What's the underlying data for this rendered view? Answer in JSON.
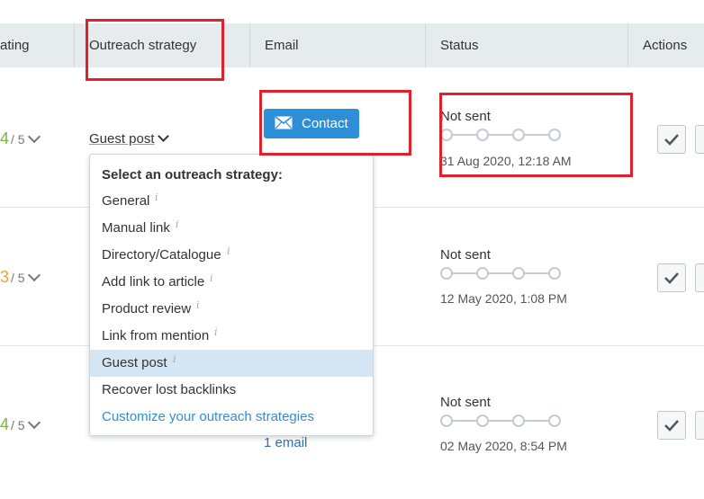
{
  "header": {
    "rating": "ating",
    "outreach": "Outreach strategy",
    "email": "Email",
    "status": "Status",
    "actions": "Actions"
  },
  "rows": [
    {
      "rating": "4",
      "rating_of": "/ 5",
      "rating_color": "#7cb342",
      "status": "Not sent",
      "date": "31 Aug 2020, 12:18 AM"
    },
    {
      "rating": "3",
      "rating_of": "/ 5",
      "rating_color": "#f0a030",
      "status": "Not sent",
      "date": "12 May 2020, 1:08 PM"
    },
    {
      "rating": "4",
      "rating_of": "/ 5",
      "rating_color": "#7cb342",
      "status": "Not sent",
      "date": "02 May 2020, 8:54 PM"
    }
  ],
  "strategy_selected": "Guest post",
  "contact_label": "Contact",
  "email_link": "1 email",
  "dropdown": {
    "title": "Select an outreach strategy:",
    "items": [
      "General",
      "Manual link",
      "Directory/Catalogue",
      "Add link to article",
      "Product review",
      "Link from mention",
      "Guest post",
      "Recover lost backlinks"
    ],
    "info_glyph": "i",
    "customize": "Customize your outreach strategies"
  },
  "colors": {
    "accent": "#2d8fd8",
    "highlight": "#e0202a",
    "selected_bg": "#d4e6f4"
  }
}
